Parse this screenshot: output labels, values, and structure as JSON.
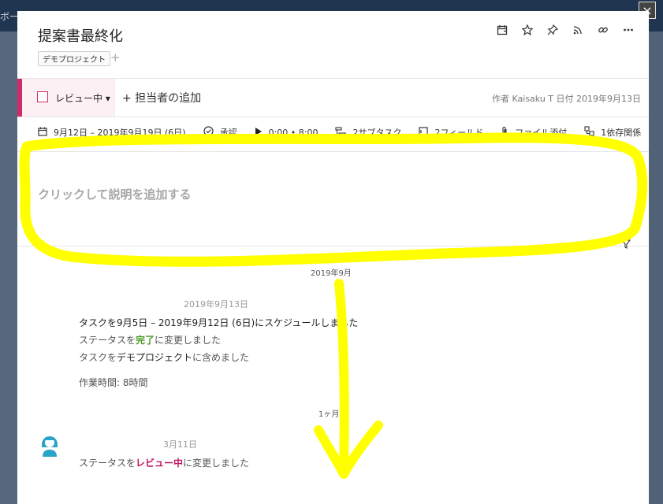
{
  "background": {
    "top_text": "ボー"
  },
  "close_label": "×",
  "task": {
    "title": "提案書最終化",
    "project_tag": "デモプロジェクト",
    "add_tag": "+"
  },
  "status": {
    "label": "レビュー中 ▾",
    "color": "#d02a6a",
    "add_assignee": "+ 担当者の追加",
    "meta": "作者 Kaisaku T 日付 2019年9月13日"
  },
  "props": {
    "dates": "9月12日 – 2019年9月19日 (6日)",
    "approval": "承認",
    "time": "0:00 • 8:00",
    "subtasks": "2サブタスク",
    "fields": "2フィールド",
    "attach": "ファイル添付",
    "dependency": "1依存関係"
  },
  "description": {
    "placeholder": "クリックして説明を追加する"
  },
  "timeline": {
    "month_sep": "2019年9月",
    "group1": {
      "date": "2019年9月13日",
      "line1": "タスクを9月5日 – 2019年9月12日 (6日)にスケジュールしました",
      "line2_pre": "ステータスを",
      "line2_status": "完了",
      "line2_post": "に変更しました",
      "line3_pre": "タスクを",
      "line3_proj": "デモプロジェクト",
      "line3_post": "に含めました",
      "work_time": "作業時間: 8時間"
    },
    "month_ago": "1ヶ月前",
    "group2": {
      "date": "3月11日",
      "line_pre": "ステータスを",
      "line_status": "レビュー中",
      "line_post": "に変更しました"
    }
  },
  "colors": {
    "annotation": "#ffff00",
    "done_status": "#4a9b27",
    "review_status": "#c01563"
  }
}
